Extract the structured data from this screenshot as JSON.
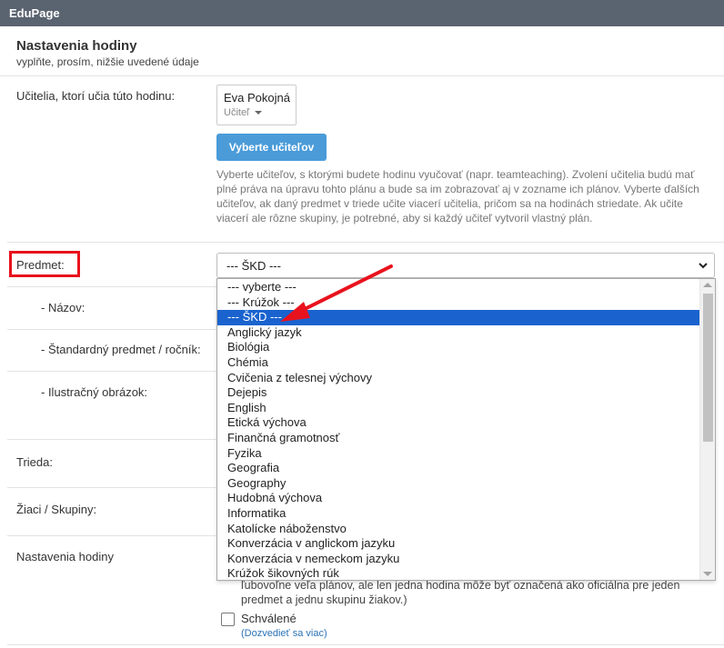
{
  "app": {
    "title": "EduPage"
  },
  "header": {
    "title": "Nastavenia hodiny",
    "subtitle": "vyplňte, prosím, nižšie uvedené údaje"
  },
  "teachers": {
    "label": "Učitelia, ktorí učia túto hodinu:",
    "selected": {
      "name": "Eva Pokojná",
      "role": "Učiteľ"
    },
    "button": "Vyberte učiteľov",
    "help": "Vyberte učiteľov, s ktorými budete hodinu vyučovať (napr. teamteaching). Zvolení učitelia budú mať plné práva na úpravu tohto plánu a bude sa im zobrazovať aj v zozname ich plánov. Vyberte ďalších učiteľov, ak daný predmet v triede učite viacerí učitelia, pričom sa na hodinách striedate. Ak učite viacerí ale rôzne skupiny, je potrebné, aby si každý učiteľ vytvoril vlastný plán."
  },
  "subject": {
    "label": "Predmet:",
    "value": "--- ŠKD ---",
    "options": [
      "--- vyberte ---",
      "--- Krúžok ---",
      "--- ŠKD ---",
      "Anglický jazyk",
      "Biológia",
      "Chémia",
      "Cvičenia z telesnej výchovy",
      "Dejepis",
      "English",
      "Etická výchova",
      "Finančná gramotnosť",
      "Fyzika",
      "Geografia",
      "Geography",
      "Hudobná výchova",
      "Informatika",
      "Katolícke náboženstvo",
      "Konverzácia v anglickom jazyku",
      "Konverzácia v nemeckom jazyku",
      "Krúžok šikovných rúk"
    ],
    "selected_index": 2
  },
  "fields": {
    "name": "- Názov:",
    "standard_subject": "- Štandardný predmet / ročník:",
    "image": "- Ilustračný obrázok:",
    "class": "Trieda:",
    "students": "Žiaci / Skupiny:",
    "lesson_settings": "Nastavenia hodiny"
  },
  "settings": {
    "note": "ľubovoľne veľa plánov, ale len jedna hodina môže byť označená ako oficiálna pre jeden predmet a jednu skupinu žiakov.)",
    "approved_label": "Schválené",
    "more_link": "(Dozvedieť sa viac)"
  },
  "colors": {
    "topbar": "#5a6370",
    "button": "#4a9bd8",
    "highlight": "#1a63cf",
    "annotation": "#e8121d",
    "link": "#2a72b5"
  }
}
